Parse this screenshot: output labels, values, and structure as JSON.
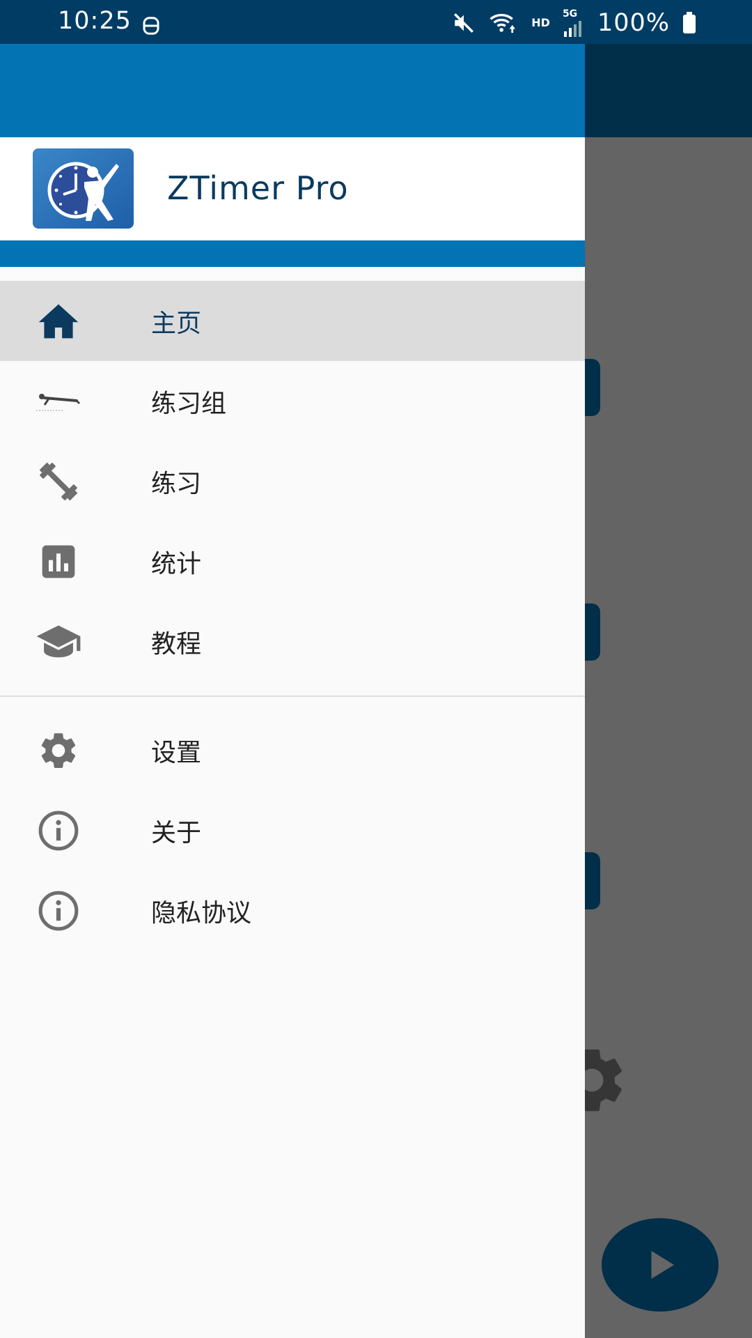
{
  "status_bar": {
    "time": "10:25",
    "network_hd": "HD",
    "network_5g": "5G",
    "battery": "100%"
  },
  "app": {
    "title": "ZTimer Pro"
  },
  "menu": {
    "items": [
      {
        "label": "主页",
        "icon": "home-icon",
        "active": true
      },
      {
        "label": "练习组",
        "icon": "plank-exercise-icon"
      },
      {
        "label": "练习",
        "icon": "dumbbell-icon"
      },
      {
        "label": "统计",
        "icon": "bar-chart-icon"
      },
      {
        "label": "教程",
        "icon": "graduation-cap-icon"
      }
    ],
    "secondary": [
      {
        "label": "设置",
        "icon": "gear-icon"
      },
      {
        "label": "关于",
        "icon": "info-icon"
      },
      {
        "label": "隐私协议",
        "icon": "info-icon"
      }
    ]
  },
  "colors": {
    "primary": "#0373b3",
    "status_bar": "#003c64",
    "title_text": "#0b3a5e",
    "drawer_bg": "#fafafa",
    "active_item_bg": "#dcdcdc",
    "icon_gray": "#6e6e6e"
  }
}
